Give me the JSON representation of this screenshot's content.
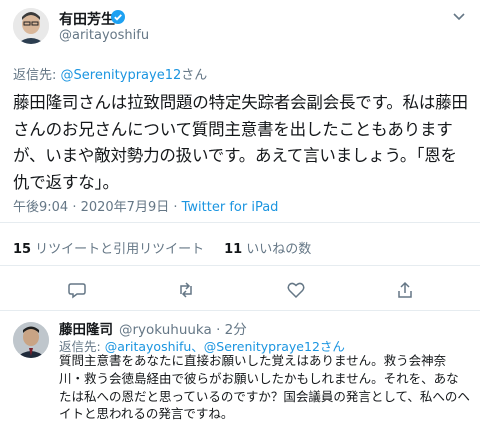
{
  "author": {
    "name": "有田芳生",
    "handle": "@aritayoshifu"
  },
  "reply_to": {
    "prefix": "返信先: ",
    "user": "@Serenitypraye12",
    "suffix": "さん"
  },
  "tweet": {
    "text": "藤田隆司さんは拉致問題の特定失踪者会副会長です。私は藤田さんのお兄さんについて質問主意書を出したこともありますが、いまや敵対勢力の扱いです。あえて言いましょう。「恩を仇で返すな」。",
    "time": "午後9:04 · 2020年7月9日 · ",
    "source": "Twitter for iPad"
  },
  "stats": {
    "retweets_count": "15",
    "retweets_label": "リツイートと引用リツイート",
    "likes_count": "11",
    "likes_label": "いいねの数"
  },
  "actions": [
    "reply-icon",
    "retweet-icon",
    "like-icon",
    "share-icon"
  ],
  "reply": {
    "name": "藤田隆司",
    "handle": "@ryokuhuuka · 2分",
    "reply_prefix": "返信先: ",
    "reply_users": "@aritayoshifu、@Serenitypraye12さん",
    "text": "質問主意書をあなたに直接お願いした覚えはありません。救う会神奈川・救う会徳島経由で彼らがお願いしたかもしれません。それを、あなたは私への恩だと思っているのですか？国会議員の発言として、私へのヘイトと思われるの発言ですね。"
  },
  "colors": {
    "link": "#1b95e0",
    "verified": "#1da1f2",
    "muted": "#657786"
  }
}
